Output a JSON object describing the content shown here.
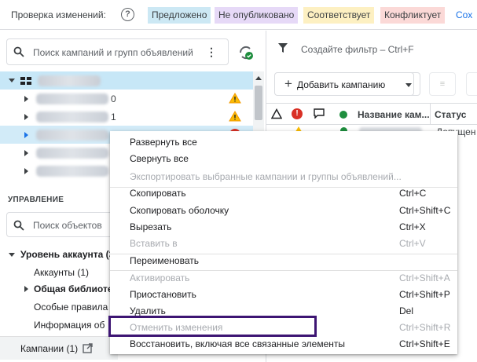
{
  "topbar": {
    "title": "Проверка изменений:",
    "help_icon_glyph": "?",
    "chips": {
      "proposed": "Предложено",
      "unpublished": "Не опубликовано",
      "matches": "Соответствует",
      "conflict": "Конфликтует"
    },
    "more": "Сох"
  },
  "tree": {
    "search_placeholder": "Поиск кампаний и групп объявлений",
    "kebab": "⋮",
    "rows": [
      {
        "suffix": ""
      },
      {
        "suffix": "0"
      },
      {
        "suffix": "1"
      },
      {
        "suffix": ""
      },
      {
        "suffix": ""
      },
      {
        "suffix": ""
      }
    ]
  },
  "management": {
    "title": "УПРАВЛЕНИЕ",
    "search_placeholder": "Поиск объектов",
    "account_level": "Уровень аккаунта (3",
    "items": [
      "Аккаунты (1)",
      "Общая библиотек",
      "Особые правила (",
      "Информация об"
    ],
    "bottom_item": "Кампании (1)"
  },
  "right": {
    "filter_placeholder": "Создайте фильтр – Ctrl+F",
    "add_campaign_label": "Добавить кампанию",
    "add_plus": "+",
    "columns": {
      "name": "Название кам...",
      "status": "Статус"
    },
    "error_glyph": "!",
    "row1_status": "Допущен"
  },
  "context_menu": {
    "items": [
      {
        "label": "Развернуть все",
        "shortcut": "",
        "disabled": false
      },
      {
        "label": "Свернуть все",
        "shortcut": "",
        "disabled": false
      },
      {
        "label": "Экспортировать выбранные кампании и группы объявлений...",
        "shortcut": "",
        "disabled": true
      },
      {
        "label": "Скопировать",
        "shortcut": "Ctrl+C",
        "disabled": false
      },
      {
        "label": "Скопировать оболочку",
        "shortcut": "Ctrl+Shift+C",
        "disabled": false
      },
      {
        "label": "Вырезать",
        "shortcut": "Ctrl+X",
        "disabled": false
      },
      {
        "label": "Вставить в",
        "shortcut": "Ctrl+V",
        "disabled": true
      },
      {
        "label": "Переименовать",
        "shortcut": "",
        "disabled": false
      },
      {
        "label": "Активировать",
        "shortcut": "Ctrl+Shift+A",
        "disabled": true
      },
      {
        "label": "Приостановить",
        "shortcut": "Ctrl+Shift+P",
        "disabled": false
      },
      {
        "label": "Удалить",
        "shortcut": "Del",
        "disabled": false
      },
      {
        "label": "Отменить изменения",
        "shortcut": "Ctrl+Shift+R",
        "disabled": true
      },
      {
        "label": "Восстановить, включая все связанные элементы",
        "shortcut": "Ctrl+Shift+E",
        "disabled": false
      }
    ]
  },
  "colors": {
    "accent": "#1a73e8",
    "highlight_box": "#3d1573",
    "selected_row": "#c7e7f7",
    "warning": "#f9ab00",
    "error": "#d93025",
    "enabled": "#1e8e3e"
  },
  "icons": [
    "help-icon",
    "search-icon",
    "sync-icon",
    "filter-icon",
    "warning-icon",
    "error-icon",
    "comment-icon",
    "external-link-icon",
    "grid-icon",
    "kebab-icon"
  ]
}
